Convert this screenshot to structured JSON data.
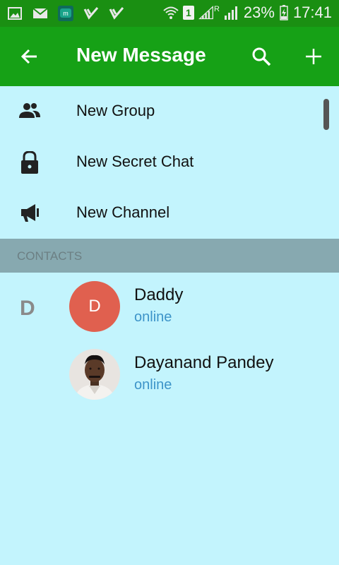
{
  "status_bar": {
    "sim_label": "1",
    "signal_label": "R",
    "battery": "23%",
    "time": "17:41",
    "notification_icons": [
      "gallery-icon",
      "mail-icon",
      "messenger-icon",
      "checkmark-icon",
      "checkmark-icon"
    ]
  },
  "toolbar": {
    "title": "New Message",
    "back_icon": "back-arrow-icon",
    "search_icon": "search-icon",
    "add_icon": "add-icon"
  },
  "menu": {
    "items": [
      {
        "label": "New Group",
        "icon": "group-icon"
      },
      {
        "label": "New Secret Chat",
        "icon": "lock-icon"
      },
      {
        "label": "New Channel",
        "icon": "megaphone-icon"
      }
    ]
  },
  "contacts": {
    "header": "CONTACTS",
    "section_letter": "D",
    "list": [
      {
        "name": "Daddy",
        "status": "online",
        "avatar_letter": "D",
        "avatar_color": "#e0604f"
      },
      {
        "name": "Dayanand Pandey",
        "status": "online",
        "avatar_letter": "",
        "avatar_type": "photo"
      }
    ]
  },
  "colors": {
    "status_bar": "#1a8f12",
    "toolbar": "#16a116",
    "background": "#c3f4fd",
    "contacts_header": "#87a9b0",
    "online": "#3d94c9"
  }
}
